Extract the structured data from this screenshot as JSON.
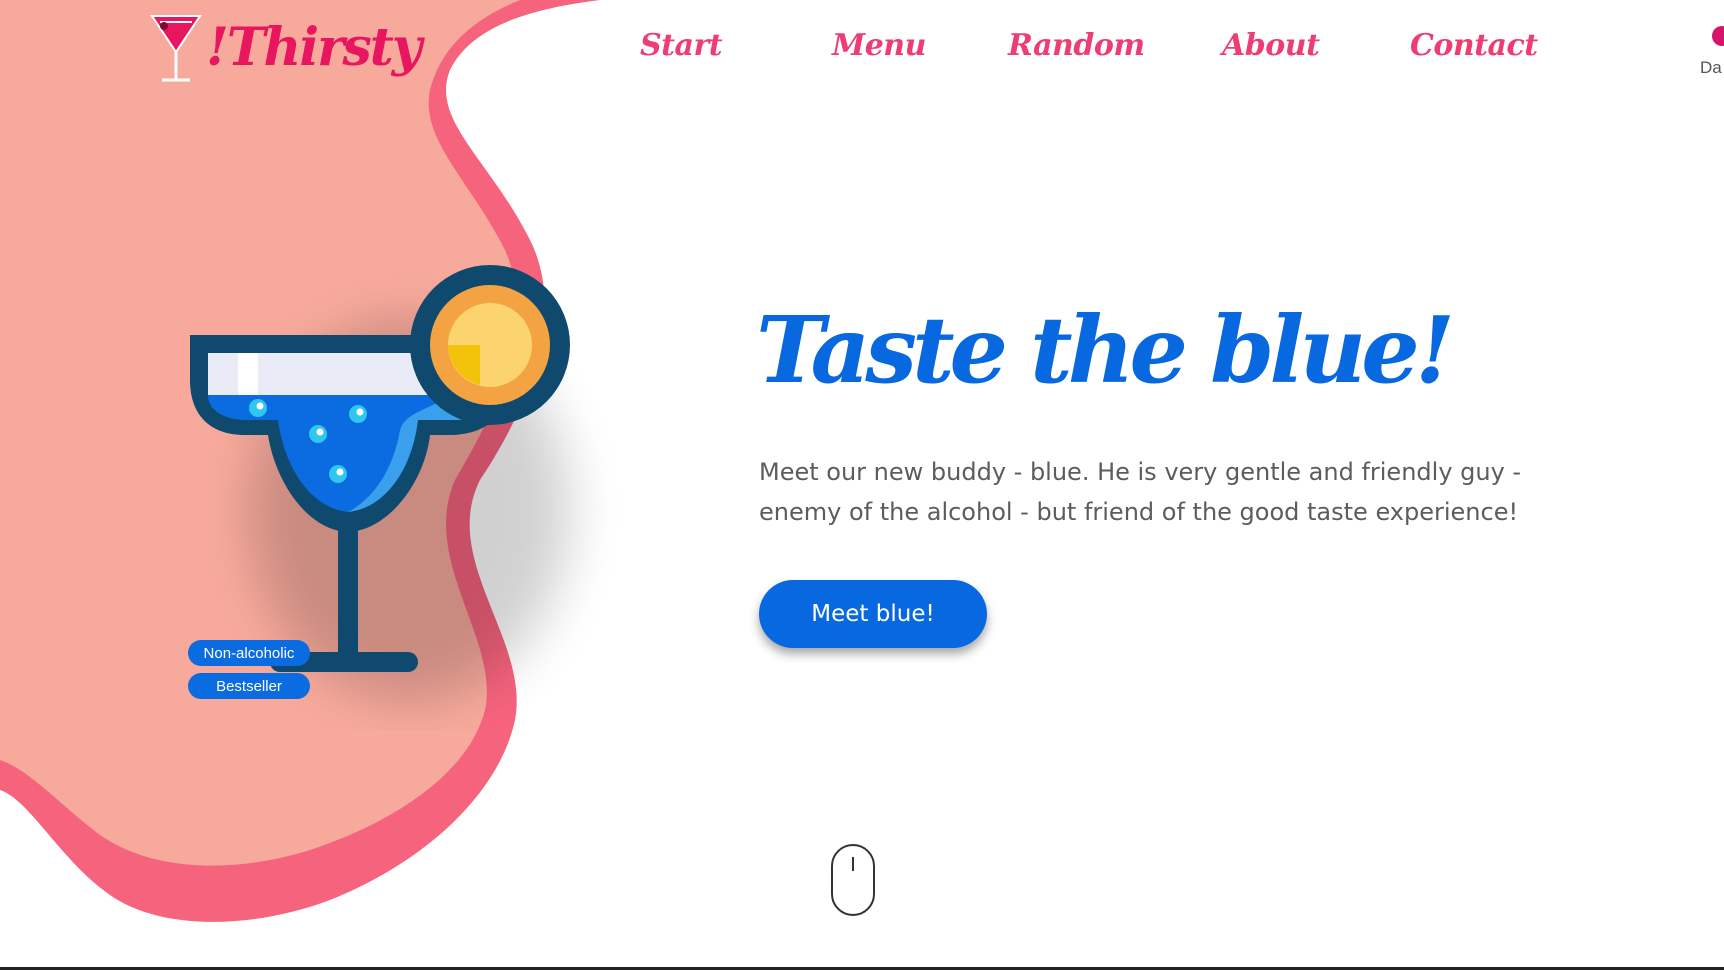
{
  "brand": {
    "name": "!Thirsty"
  },
  "nav": {
    "items": [
      {
        "label": "Start"
      },
      {
        "label": "Menu"
      },
      {
        "label": "Random"
      },
      {
        "label": "About"
      },
      {
        "label": "Contact"
      }
    ]
  },
  "dark_mode": {
    "label": "Da"
  },
  "drink": {
    "icon": "margarita-glass-icon",
    "tags": [
      {
        "label": "Non-alcoholic"
      },
      {
        "label": "Bestseller"
      }
    ]
  },
  "hero": {
    "title": "Taste the blue!",
    "description": "Meet our new buddy - blue. He is very gentle and friendly guy - enemy of the alcohol - but friend of the good taste experience!",
    "cta_label": "Meet blue!"
  },
  "scroll_indicator": {
    "icon": "mouse-scroll-icon"
  },
  "colors": {
    "brand_pink": "#e8155f",
    "nav_pink": "#ee3d72",
    "blob_outer": "#f6637d",
    "blob_inner": "#f7aa9c",
    "accent_blue": "#0868df",
    "text_gray": "#5c5c5c"
  }
}
